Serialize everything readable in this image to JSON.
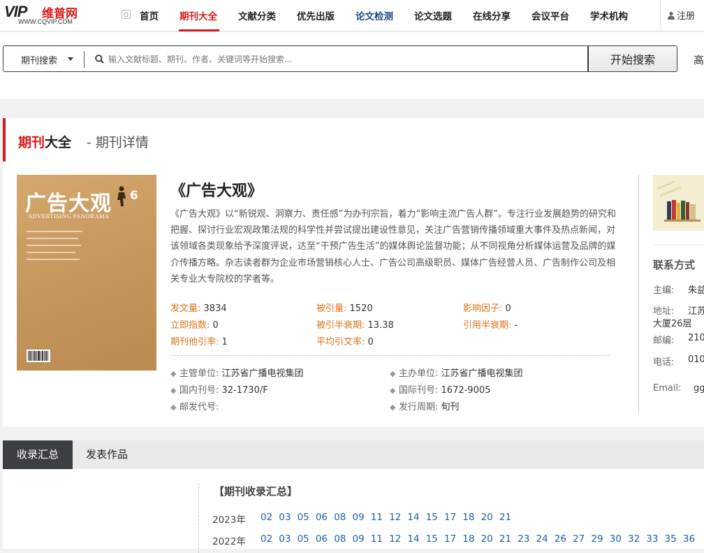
{
  "nav": {
    "logo_vip": "VIP",
    "logo_cn": "维普网",
    "logo_url": "WWW.CQVIP.COM",
    "items": [
      "首页",
      "期刊大全",
      "文献分类",
      "优先出版",
      "论文检测",
      "论文选题",
      "在线分享",
      "会议平台",
      "学术机构"
    ],
    "register": "注册"
  },
  "search": {
    "type_label": "期刊搜索",
    "placeholder": "输入文献标题、期刊、作者、关键词等开始搜索...",
    "button_label": "开始搜索",
    "advanced_label": "高"
  },
  "page": {
    "title_red": "期刊",
    "title_black": "大全",
    "subtitle": "- 期刊详情"
  },
  "cover": {
    "title": "广告大观",
    "en": "ADVERTISING PANORAMA",
    "issue": "6"
  },
  "magazine": {
    "title": "《广告大观》",
    "description": "《广告大观》以“新锐观、洞察力、责任感”为办刊宗旨，着力“影响主流广告人群”。专注行业发展趋势的研究和把握、探讨行业宏观政策法规的科学性并尝试提出建设性意见，关注广告营销传播领域重大事件及热点新闻，对该领域各类现象给予深度评说，达至“干预广告生活”的媒体舆论监督功能；从不同视角分析媒体运营及品牌的媒介传播方略。杂志读者群为企业市场营销核心人士、广告公司高级职员、媒体广告经营人员、广告制作公司及相关专业大专院校的学者等。"
  },
  "stats": [
    {
      "label": "发文量:",
      "value": "3834"
    },
    {
      "label": "被引量:",
      "value": "1520"
    },
    {
      "label": "影响因子:",
      "value": "0"
    },
    {
      "label": "立即指数:",
      "value": "0"
    },
    {
      "label": "被引半衰期:",
      "value": "13.38"
    },
    {
      "label": "引用半衰期:",
      "value": "-"
    },
    {
      "label": "期刊他引率:",
      "value": "1"
    },
    {
      "label": "平均引文率:",
      "value": "0"
    }
  ],
  "info": [
    {
      "label": "主管单位:",
      "value": "江苏省广播电视集团"
    },
    {
      "label": "主办单位:",
      "value": "江苏省广播电视集团"
    },
    {
      "label": "国内刊号:",
      "value": "32-1730/F"
    },
    {
      "label": "国际刊号:",
      "value": "1672-9005"
    },
    {
      "label": "邮发代号:",
      "value": ""
    },
    {
      "label": "发行周期:",
      "value": "旬刊"
    }
  ],
  "contact": {
    "title": "联系方式",
    "rows": [
      {
        "label": "主编:",
        "value": "朱益"
      },
      {
        "label": "地址:",
        "value": "江苏"
      },
      {
        "label": "",
        "value": "大厦26层"
      },
      {
        "label": "邮编:",
        "value": "210"
      },
      {
        "label": "电话:",
        "value": "010"
      },
      {
        "label": "Email:",
        "value": "gg"
      }
    ]
  },
  "tabs": [
    "收录汇总",
    "发表作品"
  ],
  "summary": {
    "title": "【期刊收录汇总】",
    "years": [
      {
        "year": "2023年",
        "issues": [
          "02",
          "03",
          "05",
          "06",
          "08",
          "09",
          "11",
          "12",
          "14",
          "15",
          "17",
          "18",
          "20",
          "21"
        ]
      },
      {
        "year": "2022年",
        "issues": [
          "02",
          "03",
          "05",
          "06",
          "08",
          "09",
          "11",
          "12",
          "14",
          "15",
          "17",
          "18",
          "20",
          "21",
          "23",
          "24",
          "26",
          "27",
          "29",
          "30",
          "32",
          "33",
          "35",
          "36"
        ]
      }
    ]
  },
  "colors": {
    "brand_red": "#d51a1a",
    "stat_label": "#d9731a",
    "link_blue": "#1f5fa6",
    "tab_active_bg": "#3b3f44"
  },
  "icons": [
    "home-icon",
    "user-icon",
    "chevron-down-icon",
    "search-icon",
    "diamond-icon",
    "books-icon"
  ]
}
